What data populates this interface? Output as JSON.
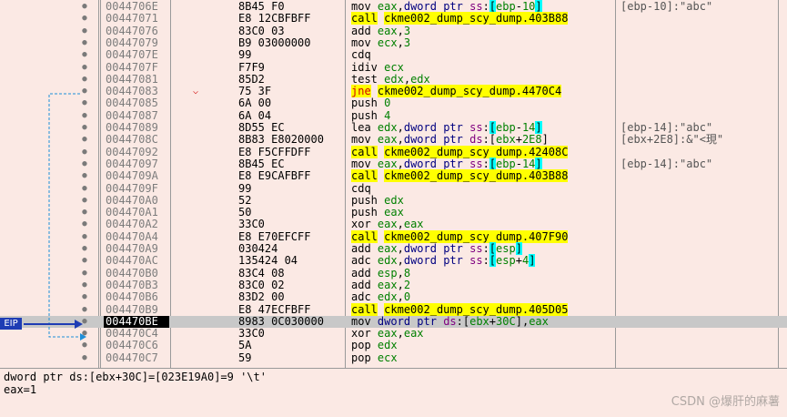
{
  "rows": [
    {
      "addr": "0044706E",
      "bytes": "8B45 F0",
      "mn": "mov",
      "ops": [
        [
          "r",
          "eax"
        ],
        [
          "t",
          ","
        ],
        [
          "m",
          "dword ptr"
        ],
        [
          "t",
          " "
        ],
        [
          "seg",
          "ss"
        ],
        [
          "t",
          ":"
        ],
        [
          "br",
          "["
        ],
        [
          "r",
          "ebp"
        ],
        [
          "t",
          "-"
        ],
        [
          "n",
          "10"
        ],
        [
          "br",
          "]"
        ]
      ],
      "cmt": "[ebp-10]:\"abc\""
    },
    {
      "addr": "00447071",
      "bytes": "E8 12CBFBFF",
      "mn": "call",
      "hl": "call",
      "ops": [
        [
          "t",
          "ckme002_dump_scy_dump.403B88"
        ]
      ],
      "cmt": ""
    },
    {
      "addr": "00447076",
      "bytes": "83C0 03",
      "mn": "add",
      "ops": [
        [
          "r",
          "eax"
        ],
        [
          "t",
          ","
        ],
        [
          "n",
          "3"
        ]
      ],
      "cmt": ""
    },
    {
      "addr": "00447079",
      "bytes": "B9 03000000",
      "mn": "mov",
      "ops": [
        [
          "r",
          "ecx"
        ],
        [
          "t",
          ","
        ],
        [
          "n",
          "3"
        ]
      ],
      "cmt": ""
    },
    {
      "addr": "0044707E",
      "bytes": "99",
      "mn": "cdq",
      "ops": [],
      "cmt": ""
    },
    {
      "addr": "0044707F",
      "bytes": "F7F9",
      "mn": "idiv",
      "ops": [
        [
          "r",
          "ecx"
        ]
      ],
      "cmt": ""
    },
    {
      "addr": "00447081",
      "bytes": "85D2",
      "mn": "test",
      "ops": [
        [
          "r",
          "edx"
        ],
        [
          "t",
          ","
        ],
        [
          "r",
          "edx"
        ]
      ],
      "cmt": ""
    },
    {
      "addr": "00447083",
      "bytes": "75 3F",
      "mn": "jne",
      "hl": "jmp",
      "ops": [
        [
          "t",
          "ckme002_dump_scy_dump.4470C4"
        ]
      ],
      "cmt": "",
      "chev": "⌵"
    },
    {
      "addr": "00447085",
      "bytes": "6A 00",
      "mn": "push",
      "ops": [
        [
          "n",
          "0"
        ]
      ],
      "cmt": ""
    },
    {
      "addr": "00447087",
      "bytes": "6A 04",
      "mn": "push",
      "ops": [
        [
          "n",
          "4"
        ]
      ],
      "cmt": ""
    },
    {
      "addr": "00447089",
      "bytes": "8D55 EC",
      "mn": "lea",
      "ops": [
        [
          "r",
          "edx"
        ],
        [
          "t",
          ","
        ],
        [
          "m",
          "dword ptr"
        ],
        [
          "t",
          " "
        ],
        [
          "seg",
          "ss"
        ],
        [
          "t",
          ":"
        ],
        [
          "br",
          "["
        ],
        [
          "r",
          "ebp"
        ],
        [
          "t",
          "-"
        ],
        [
          "n",
          "14"
        ],
        [
          "br",
          "]"
        ]
      ],
      "cmt": "[ebp-14]:\"abc\""
    },
    {
      "addr": "0044708C",
      "bytes": "8B83 E8020000",
      "mn": "mov",
      "ops": [
        [
          "r",
          "eax"
        ],
        [
          "t",
          ","
        ],
        [
          "m",
          "dword ptr"
        ],
        [
          "t",
          " "
        ],
        [
          "seg",
          "ds"
        ],
        [
          "t",
          ":"
        ],
        [
          "t",
          "["
        ],
        [
          "r",
          "ebx"
        ],
        [
          "t",
          "+"
        ],
        [
          "n",
          "2E8"
        ],
        [
          "t",
          "]"
        ]
      ],
      "cmt": "[ebx+2E8]:&\"<現\""
    },
    {
      "addr": "00447092",
      "bytes": "E8 F5CFFDFF",
      "mn": "call",
      "hl": "call",
      "ops": [
        [
          "t",
          "ckme002_dump_scy_dump.42408C"
        ]
      ],
      "cmt": ""
    },
    {
      "addr": "00447097",
      "bytes": "8B45 EC",
      "mn": "mov",
      "ops": [
        [
          "r",
          "eax"
        ],
        [
          "t",
          ","
        ],
        [
          "m",
          "dword ptr"
        ],
        [
          "t",
          " "
        ],
        [
          "seg",
          "ss"
        ],
        [
          "t",
          ":"
        ],
        [
          "br",
          "["
        ],
        [
          "r",
          "ebp"
        ],
        [
          "t",
          "-"
        ],
        [
          "n",
          "14"
        ],
        [
          "br",
          "]"
        ]
      ],
      "cmt": "[ebp-14]:\"abc\""
    },
    {
      "addr": "0044709A",
      "bytes": "E8 E9CAFBFF",
      "mn": "call",
      "hl": "call",
      "ops": [
        [
          "t",
          "ckme002_dump_scy_dump.403B88"
        ]
      ],
      "cmt": ""
    },
    {
      "addr": "0044709F",
      "bytes": "99",
      "mn": "cdq",
      "ops": [],
      "cmt": ""
    },
    {
      "addr": "004470A0",
      "bytes": "52",
      "mn": "push",
      "ops": [
        [
          "r",
          "edx"
        ]
      ],
      "cmt": ""
    },
    {
      "addr": "004470A1",
      "bytes": "50",
      "mn": "push",
      "ops": [
        [
          "r",
          "eax"
        ]
      ],
      "cmt": ""
    },
    {
      "addr": "004470A2",
      "bytes": "33C0",
      "mn": "xor",
      "ops": [
        [
          "r",
          "eax"
        ],
        [
          "t",
          ","
        ],
        [
          "r",
          "eax"
        ]
      ],
      "cmt": ""
    },
    {
      "addr": "004470A4",
      "bytes": "E8 E70EFCFF",
      "mn": "call",
      "hl": "call",
      "ops": [
        [
          "t",
          "ckme002_dump_scy_dump.407F90"
        ]
      ],
      "cmt": ""
    },
    {
      "addr": "004470A9",
      "bytes": "030424",
      "mn": "add",
      "ops": [
        [
          "r",
          "eax"
        ],
        [
          "t",
          ","
        ],
        [
          "m",
          "dword ptr"
        ],
        [
          "t",
          " "
        ],
        [
          "seg",
          "ss"
        ],
        [
          "t",
          ":"
        ],
        [
          "br",
          "["
        ],
        [
          "r",
          "esp"
        ],
        [
          "br",
          "]"
        ]
      ],
      "cmt": ""
    },
    {
      "addr": "004470AC",
      "bytes": "135424 04",
      "mn": "adc",
      "ops": [
        [
          "r",
          "edx"
        ],
        [
          "t",
          ","
        ],
        [
          "m",
          "dword ptr"
        ],
        [
          "t",
          " "
        ],
        [
          "seg",
          "ss"
        ],
        [
          "t",
          ":"
        ],
        [
          "br",
          "["
        ],
        [
          "r",
          "esp"
        ],
        [
          "t",
          "+"
        ],
        [
          "n",
          "4"
        ],
        [
          "br",
          "]"
        ]
      ],
      "cmt": ""
    },
    {
      "addr": "004470B0",
      "bytes": "83C4 08",
      "mn": "add",
      "ops": [
        [
          "r",
          "esp"
        ],
        [
          "t",
          ","
        ],
        [
          "n",
          "8"
        ]
      ],
      "cmt": ""
    },
    {
      "addr": "004470B3",
      "bytes": "83C0 02",
      "mn": "add",
      "ops": [
        [
          "r",
          "eax"
        ],
        [
          "t",
          ","
        ],
        [
          "n",
          "2"
        ]
      ],
      "cmt": ""
    },
    {
      "addr": "004470B6",
      "bytes": "83D2 00",
      "mn": "adc",
      "ops": [
        [
          "r",
          "edx"
        ],
        [
          "t",
          ","
        ],
        [
          "n",
          "0"
        ]
      ],
      "cmt": ""
    },
    {
      "addr": "004470B9",
      "bytes": "E8 47ECFBFF",
      "mn": "call",
      "hl": "call",
      "ops": [
        [
          "t",
          "ckme002_dump_scy_dump.405D05"
        ]
      ],
      "cmt": ""
    },
    {
      "addr": "004470BE",
      "bytes": "8983 0C030000",
      "mn": "mov",
      "eip": true,
      "ops": [
        [
          "m",
          "dword ptr"
        ],
        [
          "t",
          " "
        ],
        [
          "seg",
          "ds"
        ],
        [
          "t",
          ":"
        ],
        [
          "t",
          "["
        ],
        [
          "r",
          "ebx"
        ],
        [
          "t",
          "+"
        ],
        [
          "n",
          "30C"
        ],
        [
          "t",
          "]"
        ],
        [
          "t",
          ","
        ],
        [
          "r",
          "eax"
        ]
      ],
      "cmt": ""
    },
    {
      "addr": "004470C4",
      "bytes": "33C0",
      "mn": "xor",
      "ops": [
        [
          "r",
          "eax"
        ],
        [
          "t",
          ","
        ],
        [
          "r",
          "eax"
        ]
      ],
      "cmt": ""
    },
    {
      "addr": "004470C6",
      "bytes": "5A",
      "mn": "pop",
      "ops": [
        [
          "r",
          "edx"
        ]
      ],
      "cmt": ""
    },
    {
      "addr": "004470C7",
      "bytes": "59",
      "mn": "pop",
      "ops": [
        [
          "r",
          "ecx"
        ]
      ],
      "cmt": ""
    }
  ],
  "eip_label": "EIP",
  "status": {
    "line1": "dword ptr ds:[ebx+30C]=[023E19A0]=9 '\\t'",
    "line2": "eax=1"
  },
  "watermark": "CSDN @爆肝的麻薯",
  "colors": {
    "call_highlight": "#ffff00",
    "bracket_highlight": "#00ffff",
    "eip_row": "#c8c8c8",
    "background": "#fbe9e4"
  }
}
